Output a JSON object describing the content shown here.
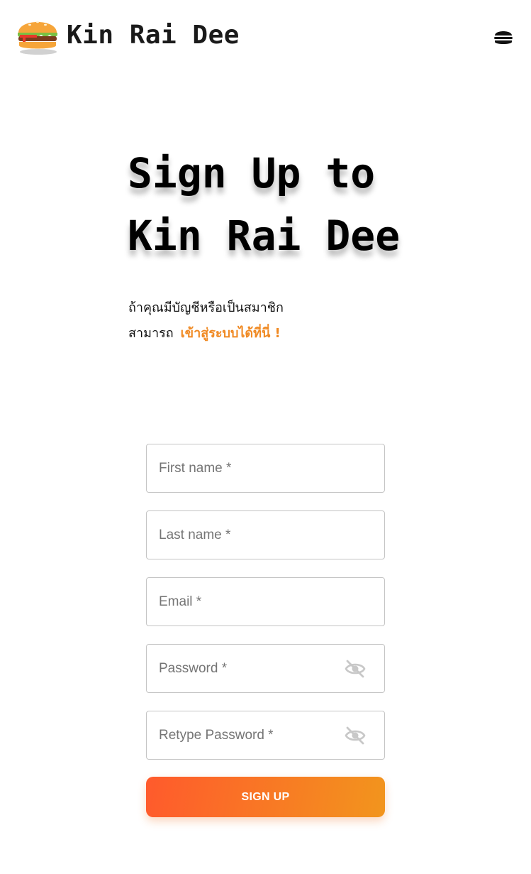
{
  "header": {
    "brand": "Kin Rai Dee",
    "logo_icon": "burger-logo-icon",
    "menu_icon": "burger-menu-icon"
  },
  "hero": {
    "title_line1": "Sign Up to",
    "title_line2": "Kin Rai Dee",
    "sub_line1": "ถ้าคุณมีบัญชีหรือเป็นสมาชิก",
    "sub_line2_prefix": "สามารถ",
    "login_link": "เข้าสู่ระบบได้ที่นี่ !"
  },
  "form": {
    "first_name_placeholder": "First name *",
    "last_name_placeholder": "Last name *",
    "email_placeholder": "Email *",
    "password_placeholder": "Password *",
    "retype_password_placeholder": "Retype Password *",
    "visibility_icon": "eye-off-icon",
    "submit_label": "SIGN UP"
  },
  "colors": {
    "accent": "#f08a24",
    "button_start": "#ff5a2c",
    "button_end": "#f2951d",
    "border": "#c4c4c4"
  }
}
